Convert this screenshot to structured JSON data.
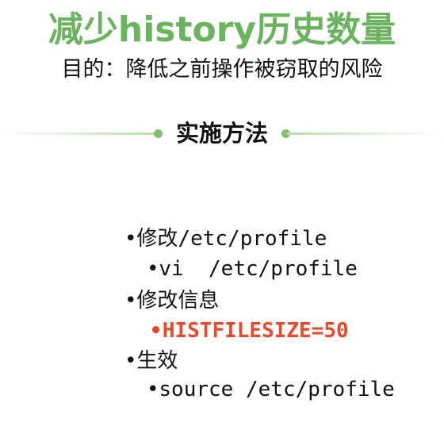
{
  "title": "减少history历史数量",
  "subtitle": "目的：降低之前操作被窃取的风险",
  "section_title": "实施方法",
  "items": [
    {
      "bullet": "•",
      "label": "修改",
      "code": "/etc/profile"
    },
    {
      "bullet": "•",
      "label": "",
      "code": "vi  /etc/profile"
    },
    {
      "bullet": "•",
      "label": "修改信息",
      "code": ""
    },
    {
      "bullet": "•",
      "label": "",
      "code": "HISTFILESIZE=50"
    },
    {
      "bullet": "•",
      "label": "生效",
      "code": ""
    },
    {
      "bullet": "•",
      "label": "",
      "code": "source /etc/profile"
    }
  ],
  "colors": {
    "title": "#6bb35f",
    "highlight": "#e8492a",
    "rule": "#b9dcae"
  }
}
